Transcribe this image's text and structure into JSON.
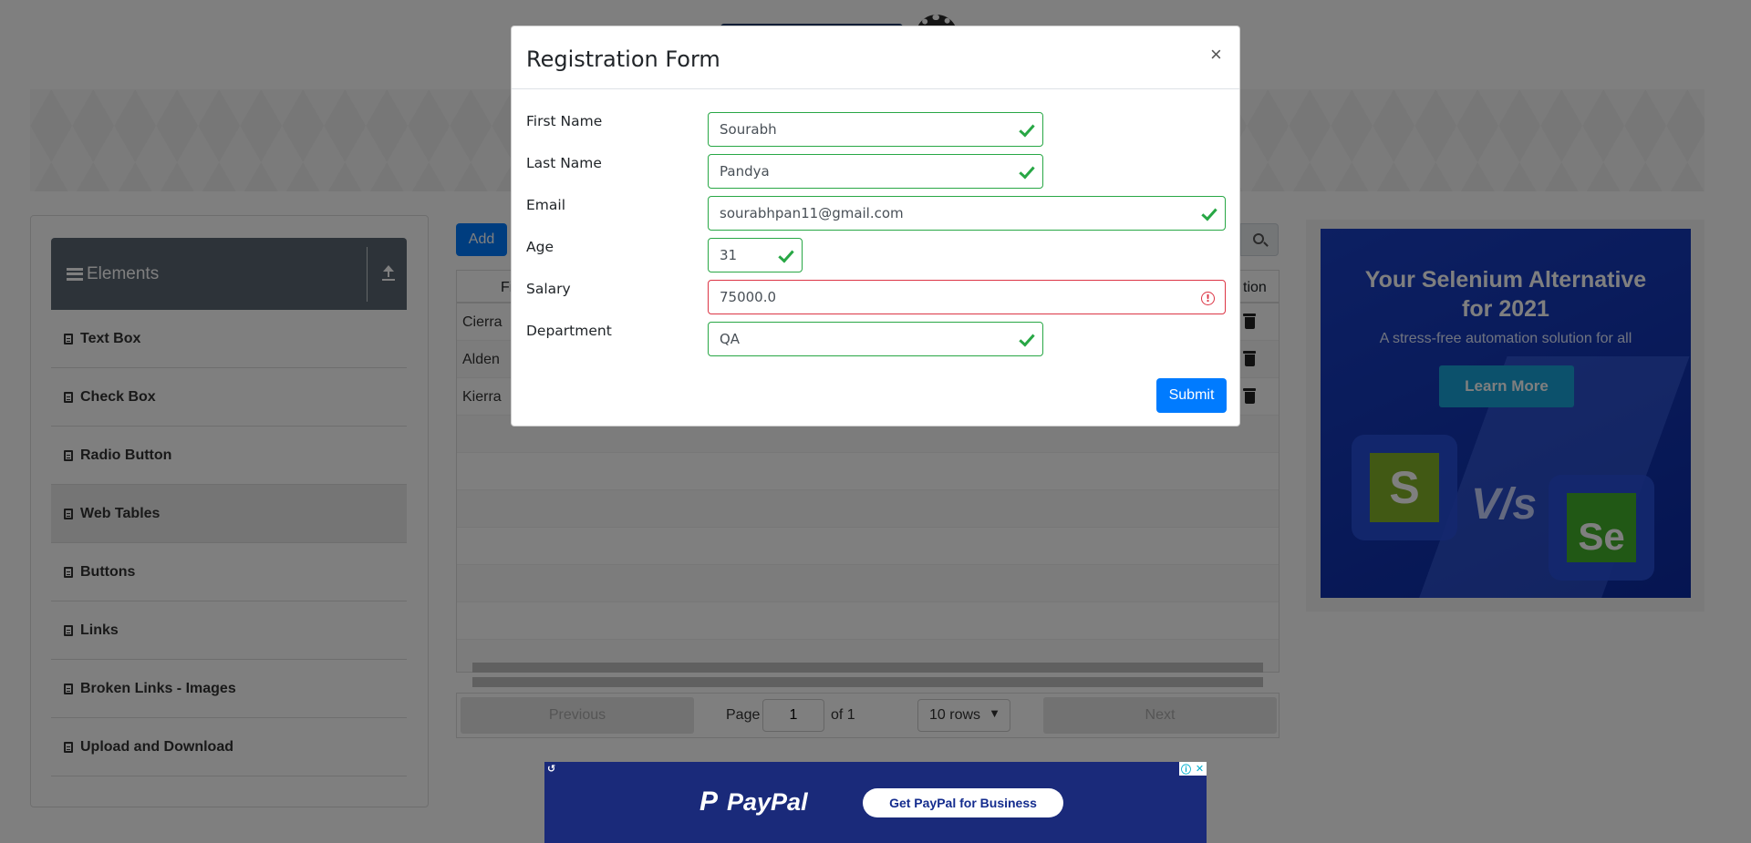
{
  "sidebar": {
    "group_title": "Elements",
    "items": [
      {
        "label": "Text Box"
      },
      {
        "label": "Check Box"
      },
      {
        "label": "Radio Button"
      },
      {
        "label": "Web Tables",
        "active": true
      },
      {
        "label": "Buttons"
      },
      {
        "label": "Links"
      },
      {
        "label": "Broken Links - Images"
      },
      {
        "label": "Upload and Download"
      }
    ]
  },
  "table": {
    "add_label": "Add",
    "header_first": "Fi",
    "header_action": "tion",
    "rows": [
      {
        "first_name": "Cierra"
      },
      {
        "first_name": "Alden"
      },
      {
        "first_name": "Kierra"
      }
    ]
  },
  "pagination": {
    "previous": "Previous",
    "next": "Next",
    "page_label": "Page",
    "page_value": "1",
    "of_label": "of 1",
    "rows_option": "10 rows"
  },
  "side_ad": {
    "headline": "Your Selenium Alternative for 2021",
    "subtitle": "A stress-free automation solution for all",
    "cta": "Learn More",
    "versus": "V/s",
    "left_logo": "S",
    "right_logo": "Se"
  },
  "bottom_ad": {
    "brand": "PayPal",
    "brand_mark": "P",
    "cta": "Get PayPal for Business"
  },
  "modal": {
    "title": "Registration Form",
    "close": "×",
    "fields": [
      {
        "label": "First Name",
        "value": "Sourabh",
        "state": "valid"
      },
      {
        "label": "Last Name",
        "value": "Pandya",
        "state": "valid"
      },
      {
        "label": "Email",
        "value": "sourabhpan11@gmail.com",
        "state": "valid"
      },
      {
        "label": "Age",
        "value": "31",
        "state": "valid"
      },
      {
        "label": "Salary",
        "value": "75000.0",
        "state": "invalid"
      },
      {
        "label": "Department",
        "value": "QA",
        "state": "valid"
      }
    ],
    "submit_label": "Submit"
  },
  "colors": {
    "valid": "#28a745",
    "invalid": "#dc3545",
    "primary": "#007bff",
    "sidebar_header": "#5a6673"
  }
}
